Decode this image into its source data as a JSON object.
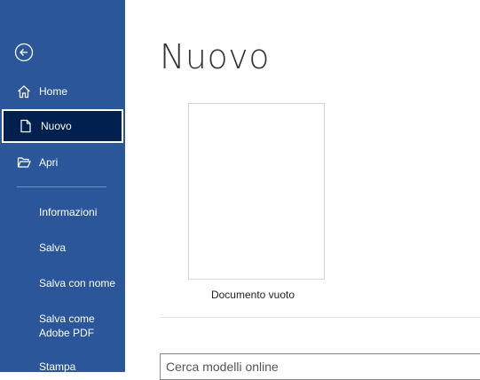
{
  "sidebar": {
    "back_icon": "back-arrow-circle-icon",
    "nav": [
      {
        "label": "Home",
        "icon": "home-icon"
      },
      {
        "label": "Nuovo",
        "icon": "new-document-icon"
      },
      {
        "label": "Apri",
        "icon": "open-folder-icon"
      }
    ],
    "menu": [
      {
        "label": "Informazioni"
      },
      {
        "label": "Salva"
      },
      {
        "label": "Salva con nome"
      },
      {
        "label": "Salva come Adobe PDF"
      },
      {
        "label": "Stampa"
      }
    ],
    "colors": {
      "background": "#2b579a",
      "selected": "#002050"
    }
  },
  "main": {
    "title": "Nuovo",
    "templates": [
      {
        "label": "Documento vuoto"
      }
    ],
    "search": {
      "placeholder": "Cerca modelli online"
    }
  }
}
